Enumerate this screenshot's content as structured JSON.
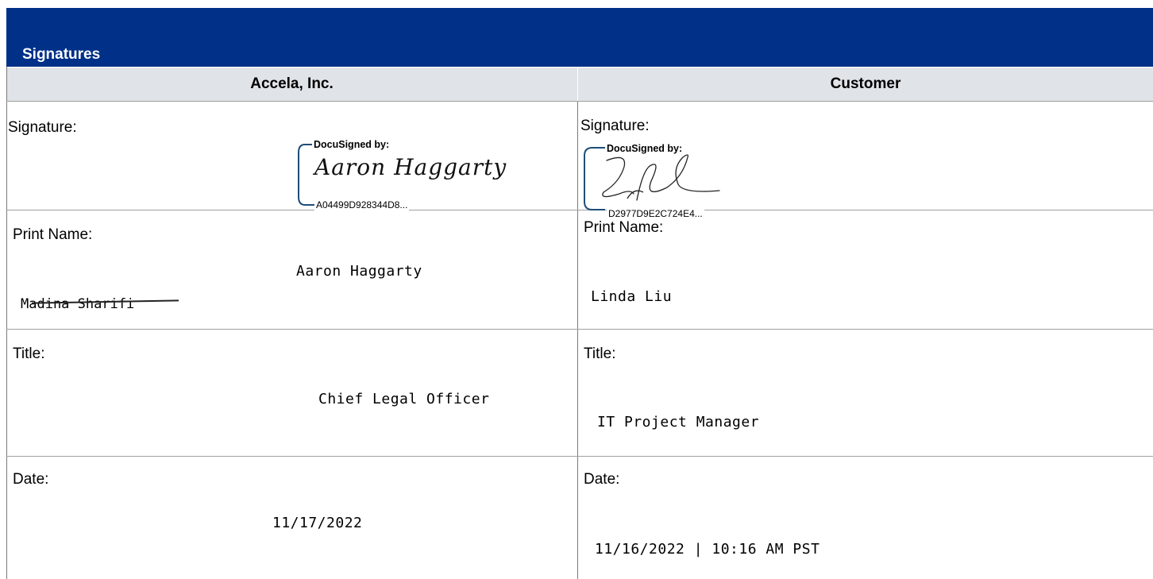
{
  "section": {
    "title": "Signatures"
  },
  "columns": {
    "left": "Accela, Inc.",
    "right": "Customer"
  },
  "labels": {
    "signature": "Signature:",
    "print_name": "Print Name:",
    "title": "Title:",
    "date": "Date:"
  },
  "docusign": {
    "signed_by": "DocuSigned by:"
  },
  "accela": {
    "signature_script": "Aaron Haggarty",
    "envelope_id": "A04499D928344D8...",
    "print_name": "Aaron Haggarty",
    "handwritten_name": "Madina Sharifi",
    "title": "Chief Legal Officer",
    "date": "11/17/2022"
  },
  "customer": {
    "envelope_id": "D2977D9E2C724E4...",
    "print_name": "Linda Liu",
    "title": "IT Project Manager",
    "date": "11/16/2022 | 10:16 AM PST"
  },
  "colors": {
    "header_blue": "#003087",
    "column_header_gray": "#e0e3e7",
    "docusign_border": "#1f4e79"
  }
}
